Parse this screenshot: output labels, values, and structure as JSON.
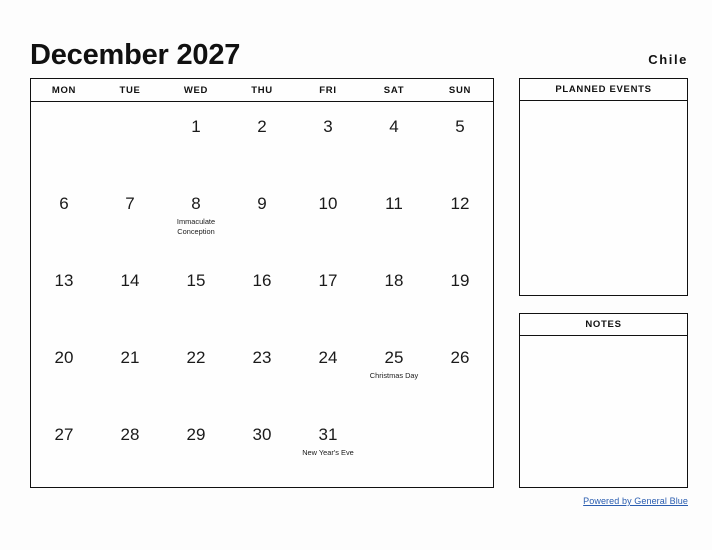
{
  "header": {
    "title": "December 2027",
    "region": "Chile"
  },
  "calendar": {
    "weekday_headers": [
      "MON",
      "TUE",
      "WED",
      "THU",
      "FRI",
      "SAT",
      "SUN"
    ],
    "weeks": [
      [
        {
          "day": "",
          "holiday": ""
        },
        {
          "day": "",
          "holiday": ""
        },
        {
          "day": "1",
          "holiday": ""
        },
        {
          "day": "2",
          "holiday": ""
        },
        {
          "day": "3",
          "holiday": ""
        },
        {
          "day": "4",
          "holiday": ""
        },
        {
          "day": "5",
          "holiday": ""
        }
      ],
      [
        {
          "day": "6",
          "holiday": ""
        },
        {
          "day": "7",
          "holiday": ""
        },
        {
          "day": "8",
          "holiday": "Immaculate Conception"
        },
        {
          "day": "9",
          "holiday": ""
        },
        {
          "day": "10",
          "holiday": ""
        },
        {
          "day": "11",
          "holiday": ""
        },
        {
          "day": "12",
          "holiday": ""
        }
      ],
      [
        {
          "day": "13",
          "holiday": ""
        },
        {
          "day": "14",
          "holiday": ""
        },
        {
          "day": "15",
          "holiday": ""
        },
        {
          "day": "16",
          "holiday": ""
        },
        {
          "day": "17",
          "holiday": ""
        },
        {
          "day": "18",
          "holiday": ""
        },
        {
          "day": "19",
          "holiday": ""
        }
      ],
      [
        {
          "day": "20",
          "holiday": ""
        },
        {
          "day": "21",
          "holiday": ""
        },
        {
          "day": "22",
          "holiday": ""
        },
        {
          "day": "23",
          "holiday": ""
        },
        {
          "day": "24",
          "holiday": ""
        },
        {
          "day": "25",
          "holiday": "Christmas Day"
        },
        {
          "day": "26",
          "holiday": ""
        }
      ],
      [
        {
          "day": "27",
          "holiday": ""
        },
        {
          "day": "28",
          "holiday": ""
        },
        {
          "day": "29",
          "holiday": ""
        },
        {
          "day": "30",
          "holiday": ""
        },
        {
          "day": "31",
          "holiday": "New Year's Eve"
        },
        {
          "day": "",
          "holiday": ""
        },
        {
          "day": "",
          "holiday": ""
        }
      ]
    ]
  },
  "panels": {
    "planned_events": {
      "title": "PLANNED EVENTS",
      "content": ""
    },
    "notes": {
      "title": "NOTES",
      "content": ""
    }
  },
  "footer": {
    "link_text": "Powered by General Blue",
    "link_color": "#2a5db0"
  }
}
